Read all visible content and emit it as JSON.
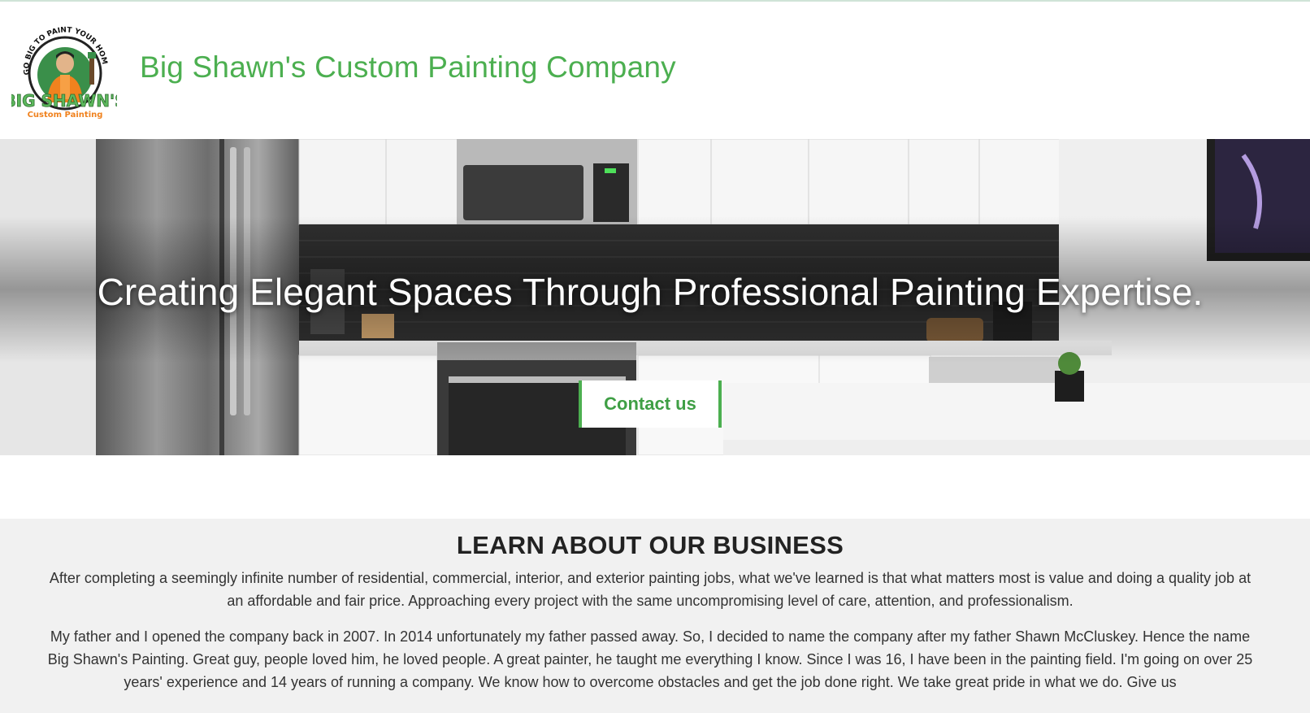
{
  "header": {
    "title": "Big Shawn's Custom Painting Company",
    "logo": {
      "arc_text": "GO BIG TO PAINT YOUR HOME",
      "name_text": "BIG SHAWN'S",
      "sub_text": "Custom Painting"
    }
  },
  "hero": {
    "headline": "Creating Elegant Spaces Through Professional Painting Expertise.",
    "cta_label": "Contact us"
  },
  "about": {
    "title": "LEARN ABOUT OUR BUSINESS",
    "paragraph1": "After completing a seemingly infinite number of residential, commercial, interior, and exterior painting jobs, what we've learned is that what matters most is value and doing a quality job at an affordable and fair price. Approaching every project with the same uncompromising level of care, attention, and professionalism.",
    "paragraph2": "My father and I opened the company back in 2007. In 2014 unfortunately my father passed away. So, I decided to name the company after my father Shawn McCluskey. Hence the name Big Shawn's Painting. Great guy, people loved him, he loved people. A great painter, he taught me everything I know. Since I was 16, I have been in the painting field. I'm going on over 25 years' experience and 14 years of running a company. We know how to overcome obstacles and get the job done right. We take great pride in what we do. Give us"
  },
  "colors": {
    "brand_green": "#4caf50",
    "about_bg": "#f1f1f1"
  }
}
